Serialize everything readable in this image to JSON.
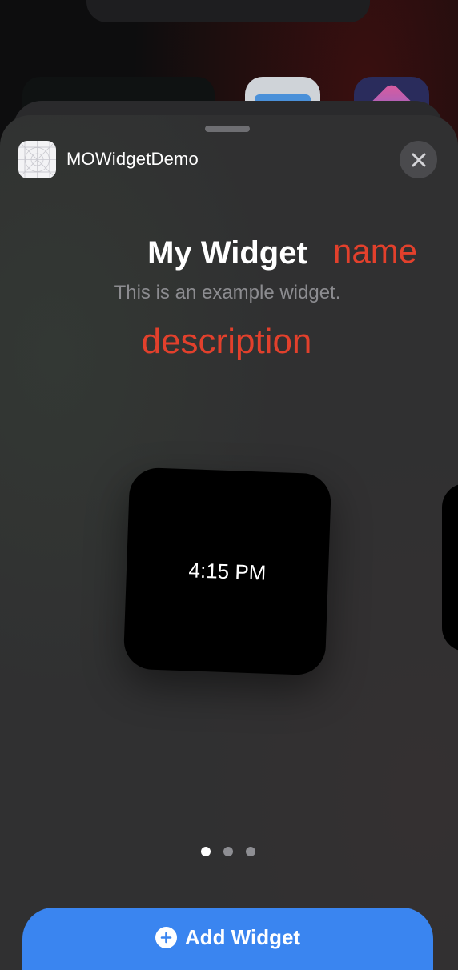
{
  "app": {
    "name": "MOWidgetDemo",
    "icon": "app-placeholder-icon"
  },
  "widget": {
    "title": "My Widget",
    "description": "This is an example widget.",
    "preview_time": "4:15 PM"
  },
  "annotations": {
    "name_label": "name",
    "description_label": "description",
    "color": "#e2402c"
  },
  "pagination": {
    "current_page": 1,
    "total_pages": 3
  },
  "actions": {
    "add_label": "Add Widget",
    "add_icon": "plus-circle-icon",
    "close_icon": "close-icon"
  },
  "colors": {
    "accent": "#3a85f0",
    "sheet": "#303031",
    "close_bg": "#4a4a4d"
  }
}
